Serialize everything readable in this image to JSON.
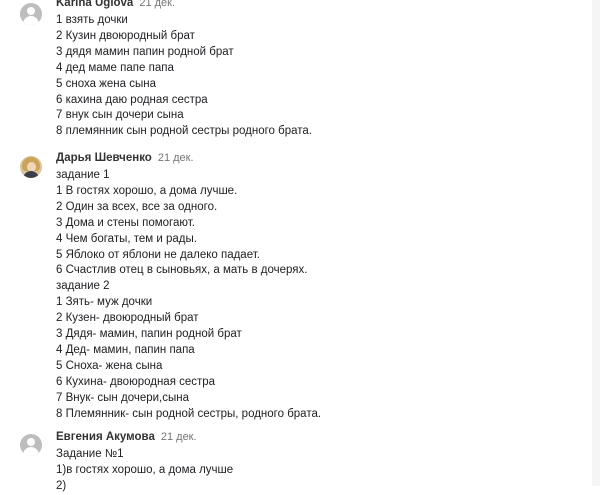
{
  "comments": [
    {
      "author": "Karina Uglova",
      "date": "21 дек.",
      "lines": [
        "1 взять дочки",
        "2 Кузин двоюродный брат",
        "3 дядя мамин папин родной брат",
        "4 дед маме папе папа",
        "5 сноха жена сына",
        "6 кахина даю родная сестра",
        "7 внук сын дочери сына",
        "8 племянник сын родной сестры родного брата."
      ]
    },
    {
      "author": "Дарья Шевченко",
      "date": "21 дек.",
      "lines": [
        "задание 1",
        "1 В гостях хорошо, а дома лучше.",
        "2 Один за всех, все за одного.",
        "3 Дома и стены помогают.",
        "4 Чем богаты, тем и рады.",
        "5 Яблоко от яблони не далеко падает.",
        "6 Счастлив отец в сыновьях, а мать в дочерях.",
        "задание 2",
        "1 Зять- муж дочки",
        "2 Кузен- двоюродный брат",
        "3 Дядя- мамин, папин родной брат",
        "4 Дед- мамин, папин папа",
        "5 Сноха- жена сына",
        "6 Кухина- двоюродная сестра",
        "7 Внук- сын дочери,сына",
        "8 Племянник- сын родной сестры, родного брата."
      ]
    },
    {
      "author": "Евгения Акумова",
      "date": "21 дек.",
      "lines": [
        "Задание №1",
        "1)в гостях хорошо, а дома лучше",
        "2)"
      ]
    }
  ]
}
